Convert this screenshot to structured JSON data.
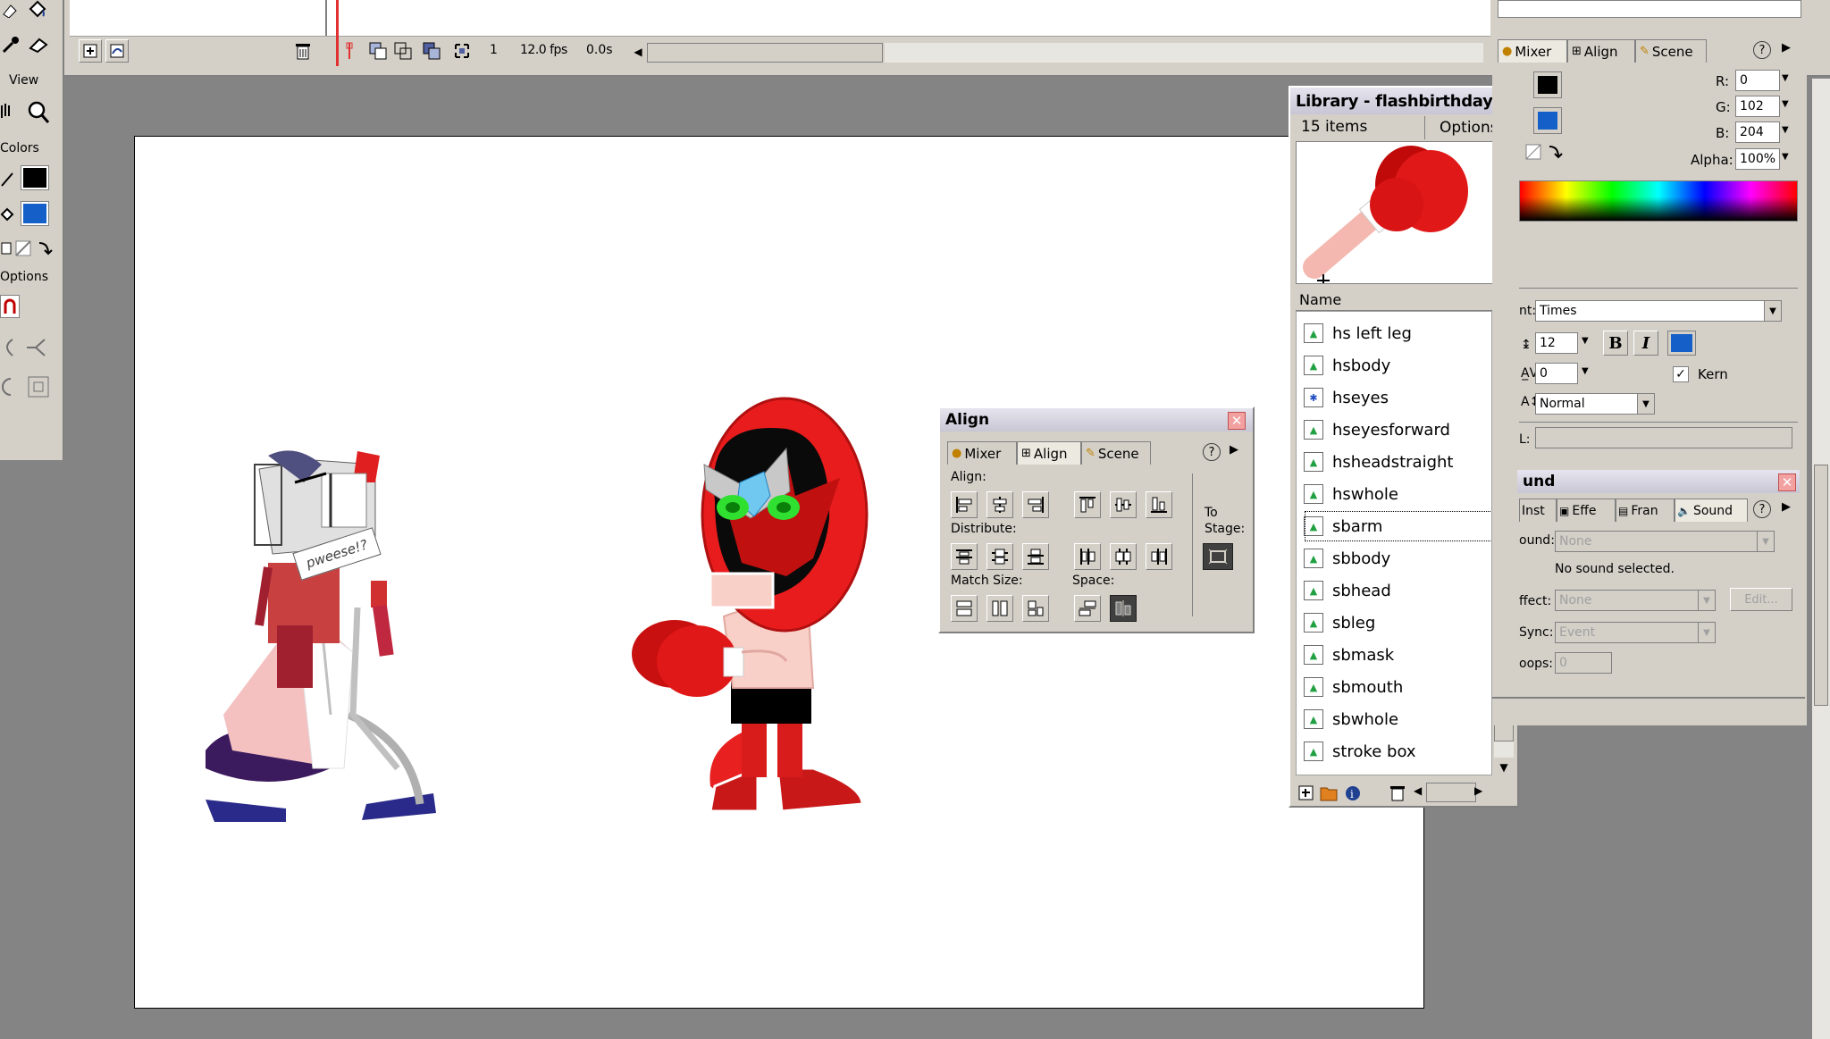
{
  "tools": {
    "view_label": "View",
    "colors_label": "Colors",
    "options_label": "Options",
    "stroke_color": "#000000",
    "fill_color": "#1560c8"
  },
  "timeline": {
    "frame": "1",
    "fps": "12.0 fps",
    "time": "0.0s"
  },
  "library": {
    "title": "Library - flashbirthday...",
    "count": "15 items",
    "options_label": "Options",
    "name_header": "Name",
    "items": [
      {
        "label": "hs left leg",
        "icon": "graphic-symbol-icon"
      },
      {
        "label": "hsbody",
        "icon": "graphic-symbol-icon"
      },
      {
        "label": "hseyes",
        "icon": "movieclip-symbol-icon"
      },
      {
        "label": "hseyesforward",
        "icon": "graphic-symbol-icon"
      },
      {
        "label": "hsheadstraight",
        "icon": "graphic-symbol-icon"
      },
      {
        "label": "hswhole",
        "icon": "graphic-symbol-icon"
      },
      {
        "label": "sbarm",
        "icon": "graphic-symbol-icon",
        "selected": true
      },
      {
        "label": "sbbody",
        "icon": "graphic-symbol-icon"
      },
      {
        "label": "sbhead",
        "icon": "graphic-symbol-icon"
      },
      {
        "label": "sbleg",
        "icon": "graphic-symbol-icon"
      },
      {
        "label": "sbmask",
        "icon": "graphic-symbol-icon"
      },
      {
        "label": "sbmouth",
        "icon": "graphic-symbol-icon"
      },
      {
        "label": "sbwhole",
        "icon": "graphic-symbol-icon"
      },
      {
        "label": "stroke box",
        "icon": "graphic-symbol-icon"
      }
    ]
  },
  "align": {
    "title": "Align",
    "tabs": [
      "Mixer",
      "Align",
      "Scene"
    ],
    "align_label": "Align:",
    "distribute_label": "Distribute:",
    "match_size_label": "Match Size:",
    "space_label": "Space:",
    "to_stage_label": "To",
    "to_stage_label2": "Stage:"
  },
  "mixer": {
    "tabs": [
      "Mixer",
      "Align",
      "Scene"
    ],
    "r_label": "R:",
    "r": "0",
    "g_label": "G:",
    "g": "102",
    "b_label": "B:",
    "b": "204",
    "alpha_label": "Alpha:",
    "alpha": "100%"
  },
  "text": {
    "font_label": "nt:",
    "font": "Times",
    "size": "12",
    "bold": "B",
    "italic": "I",
    "tracking": "0",
    "kern_label": "Kern",
    "style": "Normal",
    "url_label": "L:",
    "color": "#1560c8"
  },
  "sound": {
    "title": "und",
    "tabs": [
      "Inst",
      "Effe",
      "Fran",
      "Sound"
    ],
    "sound_label": "ound:",
    "sound_value": "None",
    "message": "No sound selected.",
    "effect_label": "ffect:",
    "effect_value": "None",
    "edit_label": "Edit...",
    "sync_label": "Sync:",
    "sync_value": "Event",
    "loops_label": "oops:",
    "loops_value": "0"
  },
  "stage": {
    "speech_text": "pweese!?"
  }
}
